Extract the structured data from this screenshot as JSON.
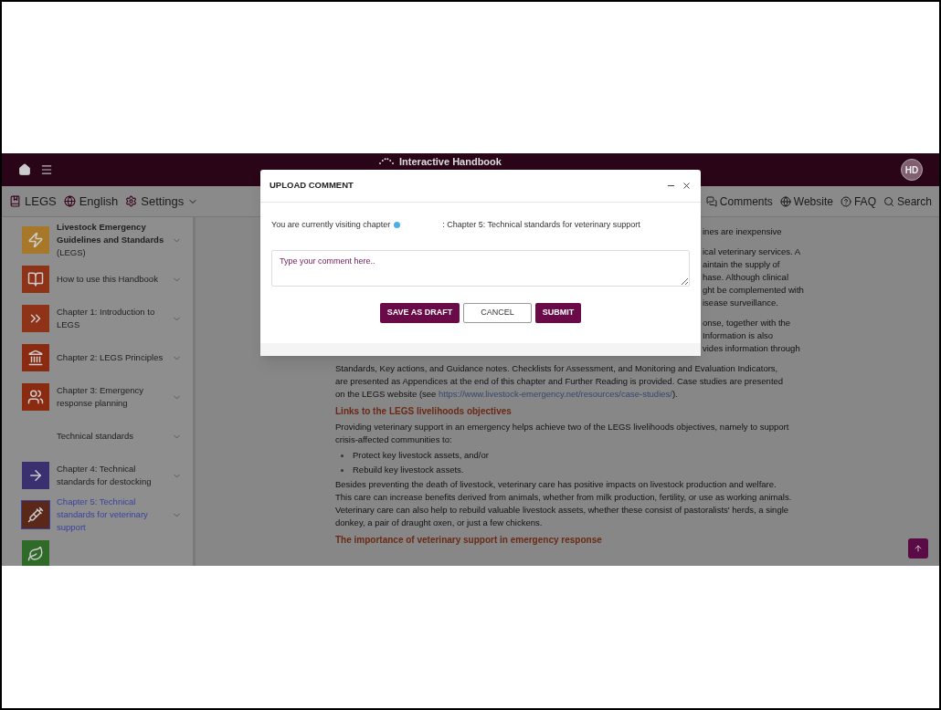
{
  "header": {
    "title": "Interactive Handbook",
    "avatar": "HD"
  },
  "toolbar": {
    "left": [
      {
        "label": "LEGS"
      },
      {
        "label": "English"
      },
      {
        "label": "Settings"
      }
    ],
    "right": [
      {
        "label": "Comments"
      },
      {
        "label": "Website"
      },
      {
        "label": "FAQ"
      },
      {
        "label": "Search"
      }
    ]
  },
  "sidebar": {
    "items": [
      {
        "label": "Livestock Emergency Guidelines and Standards",
        "sub": "(LEGS)",
        "color": "#a8782a",
        "selected": false
      },
      {
        "label": "How to use this Handbook",
        "color": "#8e3218",
        "selected": false
      },
      {
        "label": "Chapter 1: Introduction to LEGS",
        "color": "#8e3218",
        "selected": false
      },
      {
        "label": "Chapter 2: LEGS Principles",
        "color": "#8a2a10",
        "selected": false
      },
      {
        "label": "Chapter 3: Emergency response planning",
        "color": "#8a2a10",
        "selected": false
      },
      {
        "label": "Technical standards",
        "selected": false
      },
      {
        "label": "Chapter 4: Technical standards for destocking",
        "color": "#3a3070",
        "selected": false
      },
      {
        "label": "Chapter 5: Technical standards for veterinary support",
        "color": "#5a2818",
        "selected": true
      },
      {
        "color": "#2f6a28",
        "selected": false
      }
    ]
  },
  "content": [
    {
      "kind": "fragment",
      "lines": [
        {
          "text": "ines are inexpensive"
        }
      ]
    },
    {
      "kind": "fragment",
      "lines": [
        {
          "text": "ical veterinary services. A"
        },
        {
          "text": "aintain the supply of"
        },
        {
          "text": "hase. Although clinical"
        },
        {
          "text": "ght be complemented with"
        },
        {
          "text": "isease surveillance."
        }
      ]
    },
    {
      "kind": "fragment",
      "lines": [
        {
          "text": "onse, together with the"
        },
        {
          "text": "Information is also"
        },
        {
          "text": "vides information through"
        }
      ]
    },
    {
      "kind": "text",
      "lines": [
        {
          "text": "Standards, Key actions, and Guidance notes. Checklists for Assessment, and Monitoring and Evaluation Indicators,"
        },
        {
          "text": "are presented as Appendices at the end of this chapter and Further Reading is provided. Case studies are presented"
        },
        {
          "text": "on the LEGS website (see ",
          "link": "https://www.livestock-emergency.net/resources/case-studies/",
          "tail": ")."
        }
      ]
    },
    {
      "kind": "heading",
      "lines": [
        {
          "text": "Links to the LEGS livelihoods objectives"
        }
      ]
    },
    {
      "kind": "text",
      "lines": [
        {
          "text": "Providing veterinary support in an emergency helps achieve two of the LEGS livelihoods objectives, namely to support"
        },
        {
          "text": "crisis-affected communities to:"
        }
      ]
    },
    {
      "kind": "bullet",
      "lines": [
        {
          "text": "Protect key livestock assets, and/or"
        }
      ]
    },
    {
      "kind": "bullet",
      "lines": [
        {
          "text": "Rebuild key livestock assets."
        }
      ]
    },
    {
      "kind": "text",
      "lines": [
        {
          "text": "Besides preventing the death of livestock, veterinary care has positive impacts on livestock production and welfare."
        },
        {
          "text": "This care can increase benefits derived from animals, whether from milk production, fertility, or use as working animals."
        },
        {
          "text": "Veterinary care can also help to rebuild valuable livestock assets, whether these consist of pastoralists' herds, a single"
        },
        {
          "text": "donkey, a pair of draught oxen, or just a few chickens."
        }
      ]
    },
    {
      "kind": "heading",
      "lines": [
        {
          "text": "The importance of veterinary support in emergency response"
        }
      ]
    }
  ],
  "modal": {
    "title": "UPLOAD COMMENT",
    "visiting_label": "You are currently visiting chapter",
    "chapter": ": Chapter 5: Technical standards for veterinary support",
    "comment": {
      "placeholder": "Type your comment here.."
    },
    "buttons": [
      {
        "label": "SAVE AS DRAFT",
        "kind": "primary"
      },
      {
        "label": "CANCEL",
        "kind": "outline"
      },
      {
        "label": "SUBMIT",
        "kind": "primary"
      }
    ]
  }
}
